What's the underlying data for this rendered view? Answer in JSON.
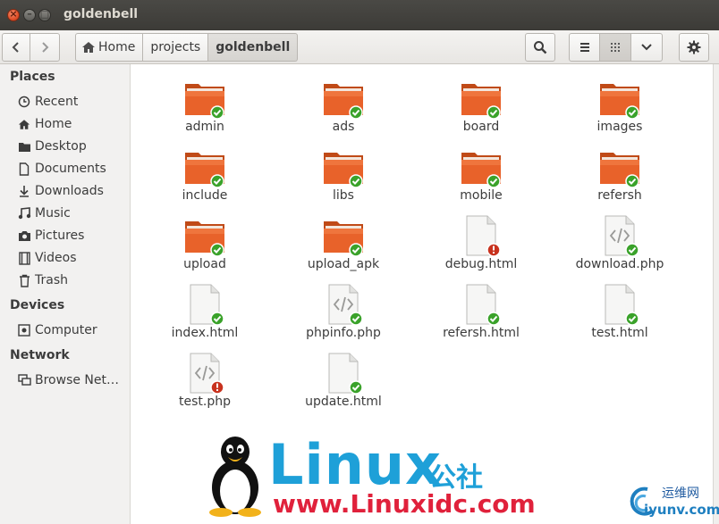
{
  "window": {
    "title": "goldenbell",
    "close_glyph": "×",
    "min_glyph": "–",
    "max_glyph": "□"
  },
  "toolbar": {
    "breadcrumbs": [
      "Home",
      "projects",
      "goldenbell"
    ],
    "back_icon": "chevron-left-icon",
    "forward_icon": "chevron-right-icon",
    "search_icon": "search-icon",
    "view_buttons": [
      "list-view-icon",
      "grid-view-icon",
      "chevron-down-icon"
    ],
    "gear_icon": "gear-icon"
  },
  "sidebar": {
    "sections": [
      {
        "title": "Places",
        "items": [
          {
            "label": "Recent",
            "icon": "clock-icon"
          },
          {
            "label": "Home",
            "icon": "home-icon"
          },
          {
            "label": "Desktop",
            "icon": "folder-icon"
          },
          {
            "label": "Documents",
            "icon": "document-icon"
          },
          {
            "label": "Downloads",
            "icon": "download-icon"
          },
          {
            "label": "Music",
            "icon": "music-icon"
          },
          {
            "label": "Pictures",
            "icon": "camera-icon"
          },
          {
            "label": "Videos",
            "icon": "film-icon"
          },
          {
            "label": "Trash",
            "icon": "trash-icon"
          }
        ]
      },
      {
        "title": "Devices",
        "items": [
          {
            "label": "Computer",
            "icon": "drive-icon"
          }
        ]
      },
      {
        "title": "Network",
        "items": [
          {
            "label": "Browse Net…",
            "icon": "network-icon"
          }
        ]
      }
    ]
  },
  "files": [
    {
      "name": "admin",
      "type": "folder",
      "badge": "ok"
    },
    {
      "name": "ads",
      "type": "folder",
      "badge": "ok"
    },
    {
      "name": "board",
      "type": "folder",
      "badge": "ok"
    },
    {
      "name": "images",
      "type": "folder",
      "badge": "ok"
    },
    {
      "name": "include",
      "type": "folder",
      "badge": "ok"
    },
    {
      "name": "libs",
      "type": "folder",
      "badge": "ok"
    },
    {
      "name": "mobile",
      "type": "folder",
      "badge": "ok"
    },
    {
      "name": "refersh",
      "type": "folder",
      "badge": "ok"
    },
    {
      "name": "upload",
      "type": "folder",
      "badge": "ok"
    },
    {
      "name": "upload_apk",
      "type": "folder",
      "badge": "ok"
    },
    {
      "name": "debug.html",
      "type": "file",
      "badge": "error"
    },
    {
      "name": "download.php",
      "type": "code",
      "badge": "ok"
    },
    {
      "name": "index.html",
      "type": "file",
      "badge": "ok"
    },
    {
      "name": "phpinfo.php",
      "type": "code",
      "badge": "ok"
    },
    {
      "name": "refersh.html",
      "type": "file",
      "badge": "ok"
    },
    {
      "name": "test.html",
      "type": "file",
      "badge": "ok"
    },
    {
      "name": "test.php",
      "type": "code",
      "badge": "error"
    },
    {
      "name": "update.html",
      "type": "file",
      "badge": "ok"
    }
  ],
  "watermark": {
    "brand": "Linux",
    "brand_cn": "公社",
    "url": "www.Linuxidc.com",
    "site2_cn": "运维网",
    "site2_url": "iyunv.com"
  },
  "colors": {
    "folder_orange": "#e8622a",
    "ok_green": "#3aa22a",
    "error_red": "#c8321e",
    "brand_blue": "#1ea0d8",
    "brand_red": "#e0213b"
  }
}
